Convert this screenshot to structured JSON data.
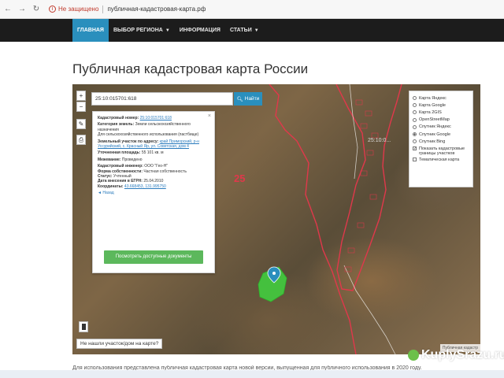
{
  "browser": {
    "insecure_label": "Не защищено",
    "url": "публичная-кадастровая-карта.рф"
  },
  "navbar": {
    "items": [
      {
        "label": "ГЛАВНАЯ"
      },
      {
        "label": "ВЫБОР РЕГИОНА"
      },
      {
        "label": "ИНФОРМАЦИЯ"
      },
      {
        "label": "СТАТЬИ"
      }
    ]
  },
  "page": {
    "title": "Публичная кадастровая карта России",
    "footer_text": "Для использования представлена публичная кадастровая карта новой версии, выпущенная для публичного использования в 2020 году."
  },
  "map": {
    "search_value": "25:10:015701:618",
    "search_button": "Найти",
    "zone_label": "25",
    "parcel_label": "25:10:0...",
    "not_found_link": "Не нашли участок/дом на карте?",
    "attribution": "Публичная кадастр",
    "colors": {
      "boundary": "#e0384b",
      "parcel": "#3fd43f",
      "accent": "#2a8fbd"
    }
  },
  "info": {
    "cadastral_number_label": "Кадастровый номер:",
    "cadastral_number": "25:10:015701:618",
    "category_label": "Категория земель:",
    "category": "Земли сельскохозяйственного назначения",
    "usage": "Для сельскохозяйственного использования (пастбище)",
    "address_label": "Земельный участок по адресу:",
    "address": "край Приморский, р-н Уссурийский, с. Красный Яр, ул. Советская, дом 4",
    "area_label": "Уточненная площадь:",
    "area": "55 101 кв. м",
    "survey_label": "Межевание:",
    "survey": "Проведено",
    "engineer_label": "Кадастровый инженер:",
    "engineer": "ООО \"Гео-Н\"",
    "ownership_label": "Форма собственности:",
    "ownership": "Частная собственность",
    "status_label": "Статус:",
    "status": "Учтенный",
    "egrn_label": "Дата внесения в ЕГРН:",
    "egrn_date": "25.04.2010",
    "coords_label": "Координаты:",
    "coords": "43.668453, 131.995750",
    "back_link": "◄ Назад",
    "docs_button": "Посмотреть доступные документы"
  },
  "layers": {
    "items": [
      {
        "label": "Карта Яндекс",
        "selected": false
      },
      {
        "label": "Карта Google",
        "selected": false
      },
      {
        "label": "Карта 2GIS",
        "selected": false
      },
      {
        "label": "OpenStreetMap",
        "selected": false
      },
      {
        "label": "Спутник Яндекс",
        "selected": false
      },
      {
        "label": "Спутник Google",
        "selected": true
      },
      {
        "label": "Спутник Bing",
        "selected": false
      }
    ],
    "show_boundaries": "Показать кадастровые границы участков",
    "thematic_map": "Тематическая карта"
  },
  "watermark": {
    "text": "KuplуSrazu.ru"
  }
}
